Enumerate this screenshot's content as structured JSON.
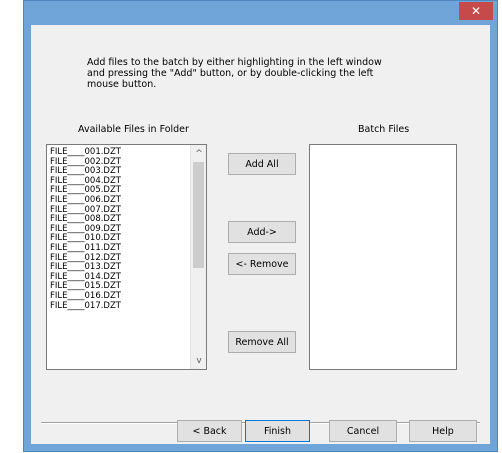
{
  "window": {
    "close_glyph": "✕",
    "accent": "#6fa5d9",
    "close_color": "#c74a4a"
  },
  "instructions": "Add files to the batch by either highlighting in the left window and pressing the \"Add\" button, or by double-clicking the left mouse button.",
  "available": {
    "label": "Available Files in Folder",
    "files": [
      "FILE____001.DZT",
      "FILE____002.DZT",
      "FILE____003.DZT",
      "FILE____004.DZT",
      "FILE____005.DZT",
      "FILE____006.DZT",
      "FILE____007.DZT",
      "FILE____008.DZT",
      "FILE____009.DZT",
      "FILE____010.DZT",
      "FILE____011.DZT",
      "FILE____012.DZT",
      "FILE____013.DZT",
      "FILE____014.DZT",
      "FILE____015.DZT",
      "FILE____016.DZT",
      "FILE____017.DZT"
    ],
    "scroll_up": "^",
    "scroll_down": "v"
  },
  "batch": {
    "label": "Batch Files"
  },
  "buttons": {
    "add_all": "Add All",
    "add": "Add->",
    "remove": "<- Remove",
    "remove_all": "Remove All",
    "back": "< Back",
    "finish": "Finish",
    "cancel": "Cancel",
    "help": "Help"
  }
}
